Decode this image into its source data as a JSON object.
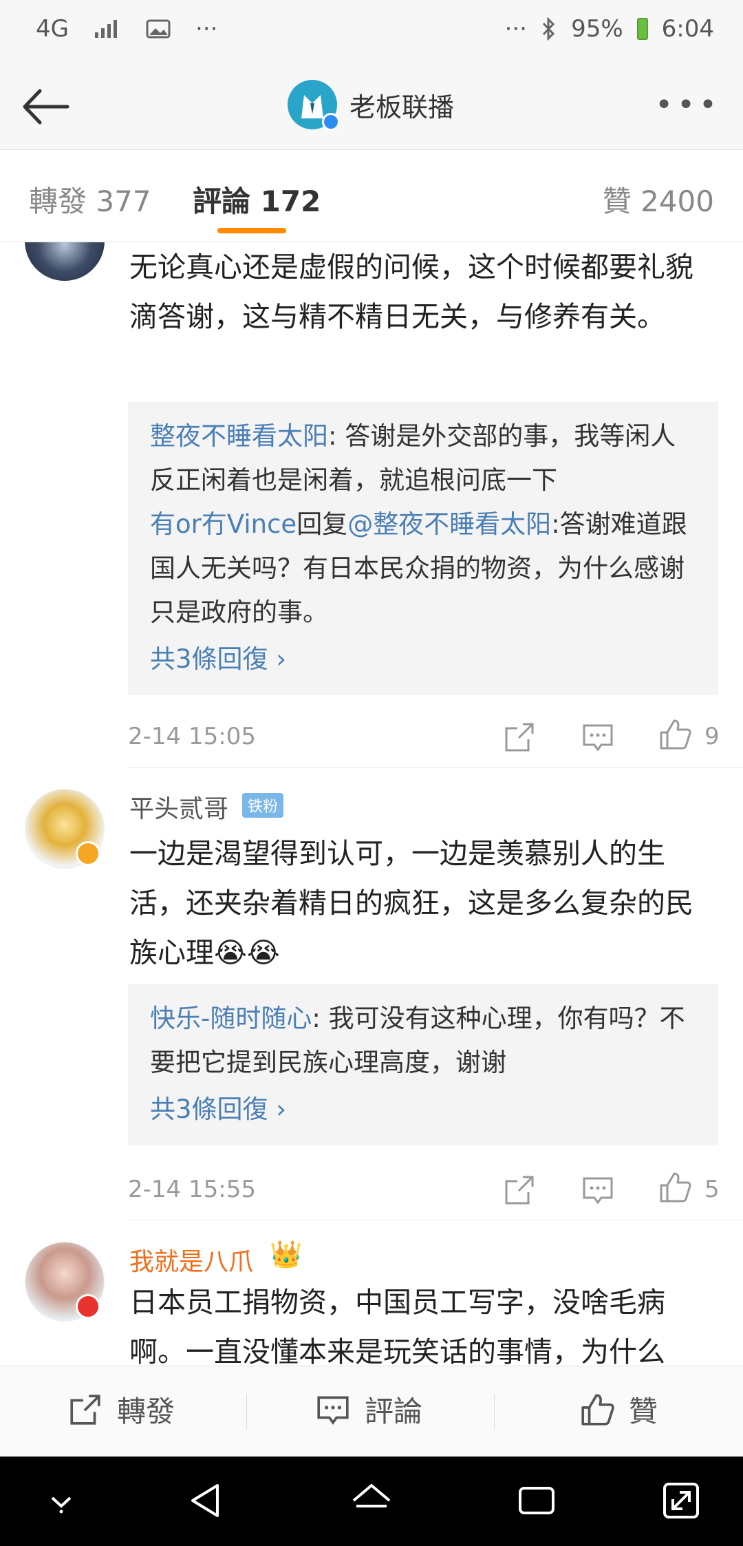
{
  "status_bar": {
    "network": "4G",
    "dots_left": "···",
    "dots_right": "···",
    "battery": "95%",
    "time": "6:04"
  },
  "nav": {
    "title": "老板联播",
    "more": "•••"
  },
  "tabs": [
    {
      "label": "轉發 377"
    },
    {
      "label": "評論 172"
    },
    {
      "label": "贊 2400"
    }
  ],
  "comments": [
    {
      "text": "无论真心还是虚假的问候，这个时候都要礼貌滴答谢，这与精不精日无关，与修养有关。",
      "replies": [
        {
          "name": "整夜不睡看太阳",
          "text": ": 答谢是外交部的事，我等闲人反正闲着也是闲着，就追根问底一下"
        },
        {
          "name": "有or冇Vince",
          "mid": "回复",
          "mention": "@整夜不睡看太阳",
          "text": ":答谢难道跟国人无关吗？有日本民众捐的物资，为什么感谢只是政府的事。"
        }
      ],
      "more_replies": "共3條回復 ›",
      "time": "2-14 15:05",
      "likes": "9"
    },
    {
      "user": "平头贰哥",
      "tag": "铁粉",
      "text": "一边是渴望得到认可，一边是羡慕别人的生活，还夹杂着精日的疯狂，这是多么复杂的民族心理😭😭",
      "replies": [
        {
          "name": "快乐-随时随心",
          "text": ": 我可没有这种心理，你有吗？不要把它提到民族心理高度，谢谢"
        }
      ],
      "more_replies": "共3條回復 ›",
      "time": "2-14 15:55",
      "likes": "5"
    },
    {
      "user": "我就是八爪",
      "crown": "👑",
      "text": "日本员工捐物资，中国员工写字，没啥毛病啊。一直没懂本来是玩笑话的事情，为什么"
    }
  ],
  "bottom_bar": {
    "repost": "轉發",
    "comment": "評論",
    "like": "贊"
  },
  "colors": {
    "accent": "#ff8a00",
    "link": "#4a7fb5",
    "username_vip": "#f06d19"
  }
}
